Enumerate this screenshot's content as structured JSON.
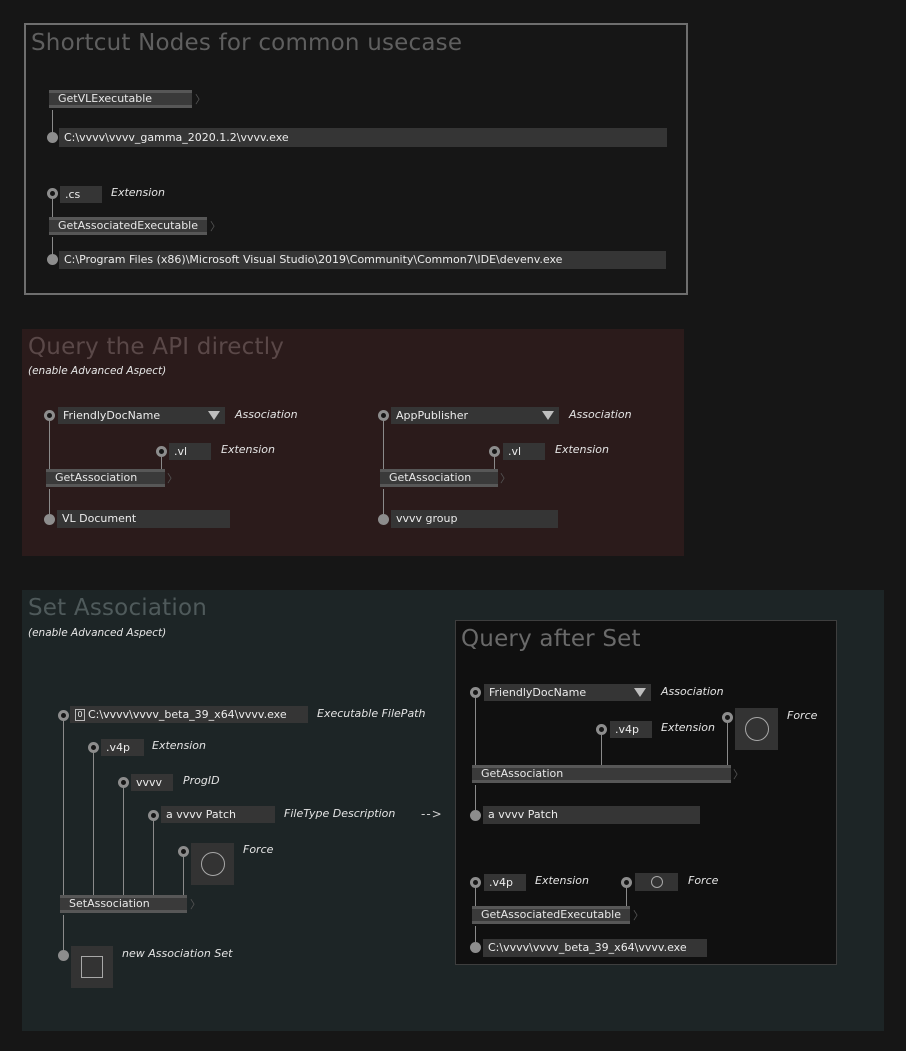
{
  "groups": {
    "shortcut": {
      "title": "Shortcut Nodes for common usecase",
      "get_vl_executable": {
        "node": "GetVLExecutable",
        "output": "C:\\vvvv\\vvvv_gamma_2020.1.2\\vvvv.exe"
      },
      "get_associated_executable": {
        "input": ".cs",
        "input_label": "Extension",
        "node": "GetAssociatedExecutable",
        "output": "C:\\Program Files (x86)\\Microsoft Visual Studio\\2019\\Community\\Common7\\IDE\\devenv.exe"
      }
    },
    "query": {
      "title": "Query the API directly",
      "subtitle": "(enable Advanced Aspect)",
      "left": {
        "association": "FriendlyDocName",
        "association_label": "Association",
        "extension": ".vl",
        "extension_label": "Extension",
        "node": "GetAssociation",
        "output": "VL Document"
      },
      "right": {
        "association": "AppPublisher",
        "association_label": "Association",
        "extension": ".vl",
        "extension_label": "Extension",
        "node": "GetAssociation",
        "output": "vvvv group"
      }
    },
    "set": {
      "title": "Set Association",
      "subtitle": "(enable Advanced Aspect)",
      "filepath_icon": "0",
      "filepath": "C:\\vvvv\\vvvv_beta_39_x64\\vvvv.exe",
      "filepath_label": "Executable FilePath",
      "extension": ".v4p",
      "extension_label": "Extension",
      "progid": "vvvv",
      "progid_label": "ProgID",
      "filetype": "a vvvv Patch",
      "filetype_label": "FileType Description",
      "force_label": "Force",
      "node": "SetAssociation",
      "result_label": "new Association Set",
      "arrow": "-->"
    },
    "query_after": {
      "title": "Query after Set",
      "association": "FriendlyDocName",
      "association_label": "Association",
      "extension": ".v4p",
      "extension_label": "Extension",
      "force_label": "Force",
      "node": "GetAssociation",
      "output": "a vvvv Patch",
      "exe_extension": ".v4p",
      "exe_extension_label": "Extension",
      "exe_force_label": "Force",
      "exe_node": "GetAssociatedExecutable",
      "exe_output": "C:\\vvvv\\vvvv_beta_39_x64\\vvvv.exe"
    }
  },
  "colors": {
    "background": "#161616",
    "shortcut_group": "#161616",
    "query_group": "#2b1b1b",
    "set_group": "#1d2526",
    "query_after_group": "#101010"
  }
}
